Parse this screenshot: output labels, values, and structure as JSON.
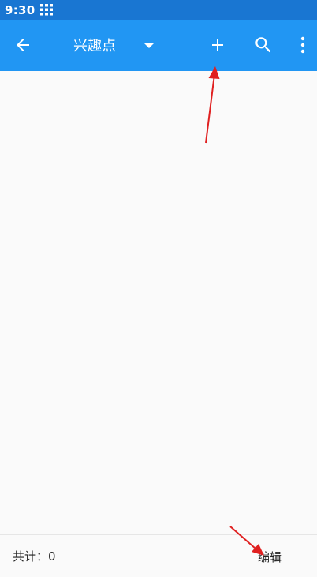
{
  "status_bar": {
    "time": "9:30",
    "grid_icon": "grid-icon"
  },
  "app_bar": {
    "back_icon": "arrow-left-icon",
    "title": "兴趣点",
    "dropdown_icon": "caret-down-icon",
    "add_icon": "plus-icon",
    "search_icon": "search-icon",
    "more_icon": "more-vert-icon"
  },
  "bottom_bar": {
    "total_label": "共计：",
    "total_count": "0",
    "edit_label": "编辑"
  },
  "colors": {
    "status_bar": "#1976d2",
    "app_bar": "#2196f3",
    "background": "#fafafa",
    "annotation_arrow": "#e02020"
  }
}
